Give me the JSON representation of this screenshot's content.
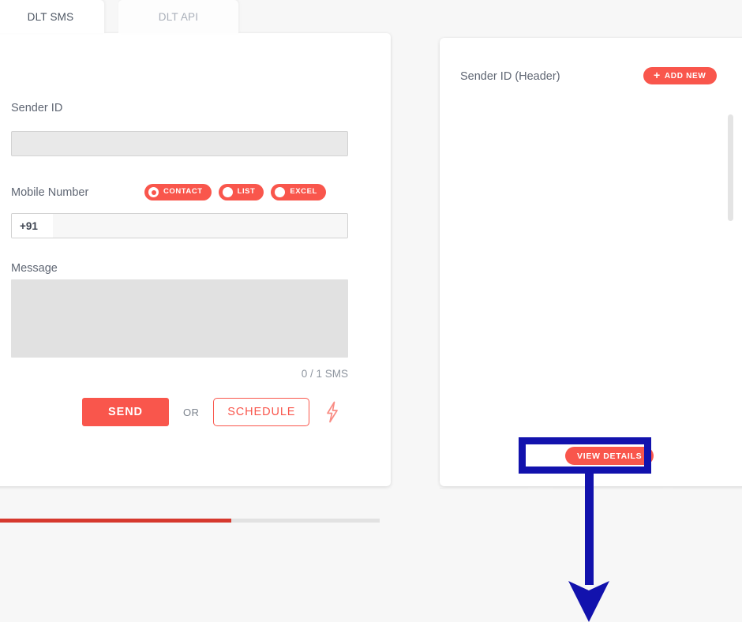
{
  "colors": {
    "accent": "#f9564c",
    "accent_dark": "#d6392e",
    "annotation": "#1212ad",
    "page_bg": "#f7f7f7",
    "card_bg": "#ffffff",
    "label_text": "#5f6673",
    "muted_text": "#8e959f",
    "input_bg": "#e9e9e9",
    "textarea_bg": "#e1e1e1"
  },
  "tabs": [
    {
      "label": "DLT SMS",
      "active": true
    },
    {
      "label": "DLT API",
      "active": false
    }
  ],
  "compose_panel": {
    "sender_id": {
      "label": "Sender ID",
      "value": "",
      "placeholder": ""
    },
    "mobile_number": {
      "label": "Mobile Number",
      "prefix": "+91",
      "value": "",
      "placeholder": "",
      "source_options": [
        {
          "label": "CONTACT",
          "selected": true,
          "icon": "radio-selected-icon"
        },
        {
          "label": "LIST",
          "selected": false,
          "icon": "radio-unselected-icon"
        },
        {
          "label": "EXCEL",
          "selected": false,
          "icon": "radio-unselected-icon"
        }
      ]
    },
    "message": {
      "label": "Message",
      "value": "",
      "placeholder": "",
      "counter": "0 / 1 SMS"
    },
    "actions": {
      "send_label": "SEND",
      "or_label": "OR",
      "schedule_label": "SCHEDULE",
      "flash_icon": "flash-bolt-icon"
    },
    "progress": {
      "fill_percent": 62
    }
  },
  "sender_panel": {
    "title": "Sender ID (Header)",
    "add_new_label": "ADD NEW",
    "add_new_icon": "plus-icon",
    "view_details_label": "VIEW DETAILS",
    "scrollbar": "vertical-scrollbar",
    "items": []
  },
  "annotation": {
    "target": "view-details-button",
    "shape": "rectangle-with-down-arrow",
    "color": "#1212ad"
  }
}
